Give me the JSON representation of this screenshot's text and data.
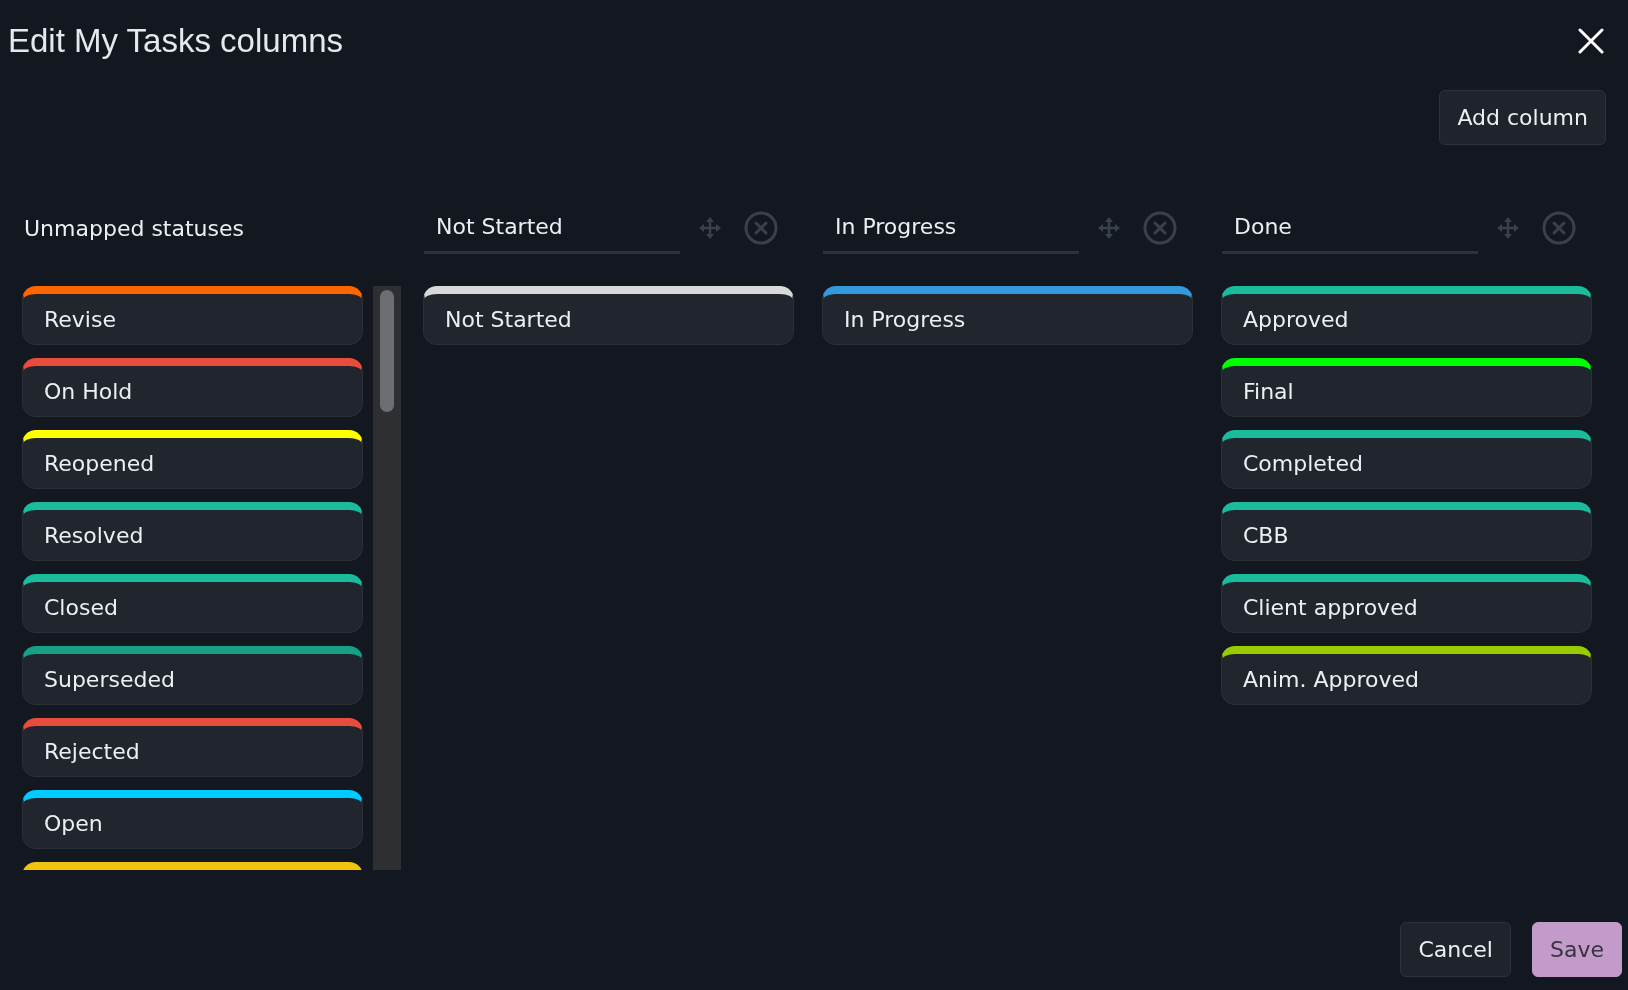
{
  "dialog": {
    "title": "Edit My Tasks columns"
  },
  "add_column_button": "Add column",
  "unmapped": {
    "title": "Unmapped statuses",
    "statuses": [
      {
        "name": "Revise",
        "color": "#ff6600"
      },
      {
        "name": "On Hold",
        "color": "#e74c3c"
      },
      {
        "name": "Reopened",
        "color": "#ffff00"
      },
      {
        "name": "Resolved",
        "color": "#1abc9c"
      },
      {
        "name": "Closed",
        "color": "#1abc9c"
      },
      {
        "name": "Superseded",
        "color": "#16a085"
      },
      {
        "name": "Rejected",
        "color": "#e74c3c"
      },
      {
        "name": "Open",
        "color": "#00ccff"
      },
      {
        "color": "#f1c40f"
      }
    ]
  },
  "columns": [
    {
      "name": "Not Started",
      "statuses": [
        {
          "name": "Not Started",
          "color": "#d9d9d9"
        }
      ]
    },
    {
      "name": "In Progress",
      "statuses": [
        {
          "name": "In Progress",
          "color": "#3498db"
        }
      ]
    },
    {
      "name": "Done",
      "statuses": [
        {
          "name": "Approved",
          "color": "#1abc9c"
        },
        {
          "name": "Final",
          "color": "#00ff00"
        },
        {
          "name": "Completed",
          "color": "#1abc9c"
        },
        {
          "name": "CBB",
          "color": "#1abc9c"
        },
        {
          "name": "Client approved",
          "color": "#1abc9c"
        },
        {
          "name": "Anim. Approved",
          "color": "#99cc00"
        }
      ]
    }
  ],
  "buttons": {
    "cancel": "Cancel",
    "save": "Save"
  }
}
